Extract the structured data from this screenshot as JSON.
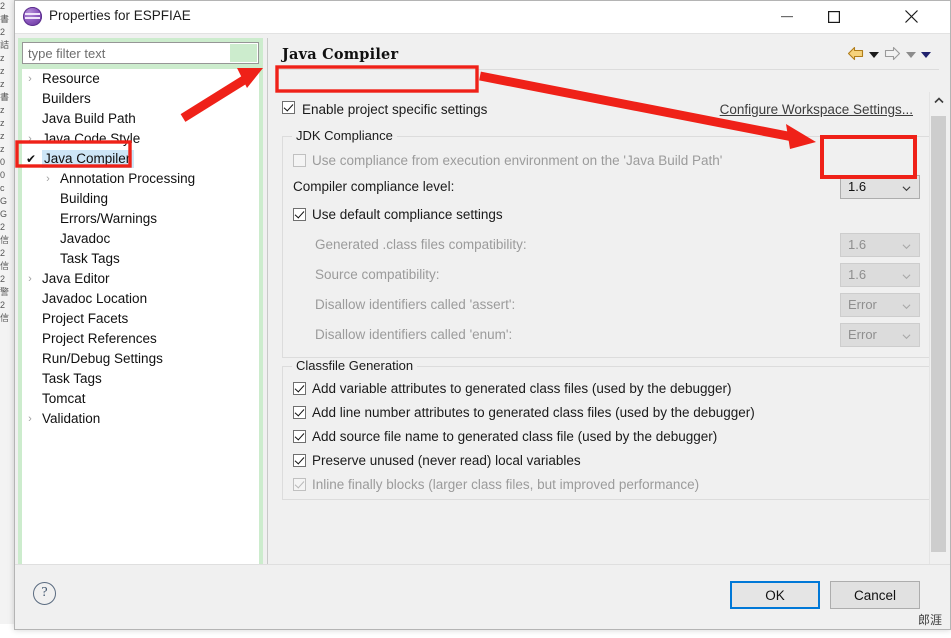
{
  "window": {
    "title": "Properties for ESPFIAE",
    "icon": "eclipse-sphere-icon",
    "minimize_label": "Minimize",
    "maximize_label": "Maximize",
    "close_label": "Close"
  },
  "sidebar": {
    "filter": {
      "placeholder": "type filter text",
      "value": ""
    },
    "items": [
      {
        "label": "Resource",
        "depth": 0,
        "twisty": "›",
        "selected": false
      },
      {
        "label": "Builders",
        "depth": 0,
        "twisty": "",
        "selected": false
      },
      {
        "label": "Java Build Path",
        "depth": 0,
        "twisty": "",
        "selected": false
      },
      {
        "label": "Java Code Style",
        "depth": 0,
        "twisty": "›",
        "selected": false
      },
      {
        "label": "Java Compiler",
        "depth": 0,
        "twisty": "",
        "selected": true,
        "check": "✔"
      },
      {
        "label": "Annotation Processing",
        "depth": 1,
        "twisty": "›",
        "selected": false
      },
      {
        "label": "Building",
        "depth": 1,
        "twisty": "",
        "selected": false
      },
      {
        "label": "Errors/Warnings",
        "depth": 1,
        "twisty": "",
        "selected": false
      },
      {
        "label": "Javadoc",
        "depth": 1,
        "twisty": "",
        "selected": false
      },
      {
        "label": "Task Tags",
        "depth": 1,
        "twisty": "",
        "selected": false
      },
      {
        "label": "Java Editor",
        "depth": 0,
        "twisty": "›",
        "selected": false
      },
      {
        "label": "Javadoc Location",
        "depth": 0,
        "twisty": "",
        "selected": false
      },
      {
        "label": "Project Facets",
        "depth": 0,
        "twisty": "",
        "selected": false
      },
      {
        "label": "Project References",
        "depth": 0,
        "twisty": "",
        "selected": false
      },
      {
        "label": "Run/Debug Settings",
        "depth": 0,
        "twisty": "",
        "selected": false
      },
      {
        "label": "Task Tags",
        "depth": 0,
        "twisty": "",
        "selected": false
      },
      {
        "label": "Tomcat",
        "depth": 0,
        "twisty": "",
        "selected": false
      },
      {
        "label": "Validation",
        "depth": 0,
        "twisty": "›",
        "selected": false
      }
    ]
  },
  "page": {
    "title": "Java Compiler",
    "enable_project_specific": {
      "label": "Enable project specific settings",
      "checked": true
    },
    "configure_workspace_link": "Configure Workspace Settings...",
    "jdk_group": {
      "title": "JDK Compliance",
      "use_execution_env": {
        "label_before": "Use compliance from execution environment on the ",
        "link": "'Java Build Path'",
        "checked": false,
        "enabled": false
      },
      "compliance_level": {
        "label": "Compiler compliance level:",
        "value": "1.6",
        "enabled": true
      },
      "use_default": {
        "label": "Use default compliance settings",
        "checked": true,
        "enabled": true
      },
      "rows": [
        {
          "label": "Generated .class files compatibility:",
          "value": "1.6",
          "enabled": false
        },
        {
          "label": "Source compatibility:",
          "value": "1.6",
          "enabled": false
        },
        {
          "label": "Disallow identifiers called 'assert':",
          "value": "Error",
          "enabled": false
        },
        {
          "label": "Disallow identifiers called 'enum':",
          "value": "Error",
          "enabled": false
        }
      ]
    },
    "classfile_group": {
      "title": "Classfile Generation",
      "checkboxes": [
        {
          "label": "Add variable attributes to generated class files (used by the debugger)",
          "checked": true,
          "enabled": true
        },
        {
          "label": "Add line number attributes to generated class files (used by the debugger)",
          "checked": true,
          "enabled": true
        },
        {
          "label": "Add source file name to generated class file (used by the debugger)",
          "checked": true,
          "enabled": true
        },
        {
          "label": "Preserve unused (never read) local variables",
          "checked": true,
          "enabled": true
        },
        {
          "label": "Inline finally blocks (larger class files, but improved performance)",
          "checked": true,
          "enabled": false
        }
      ]
    }
  },
  "footer": {
    "help_label": "?",
    "ok_label": "OK",
    "cancel_label": "Cancel",
    "watermark": "郎涯"
  },
  "colors": {
    "annotation_red": "#ef2118",
    "selection_blue": "#cde6f7",
    "sidebar_green": "#cceccd",
    "focus_blue": "#0078d7"
  }
}
